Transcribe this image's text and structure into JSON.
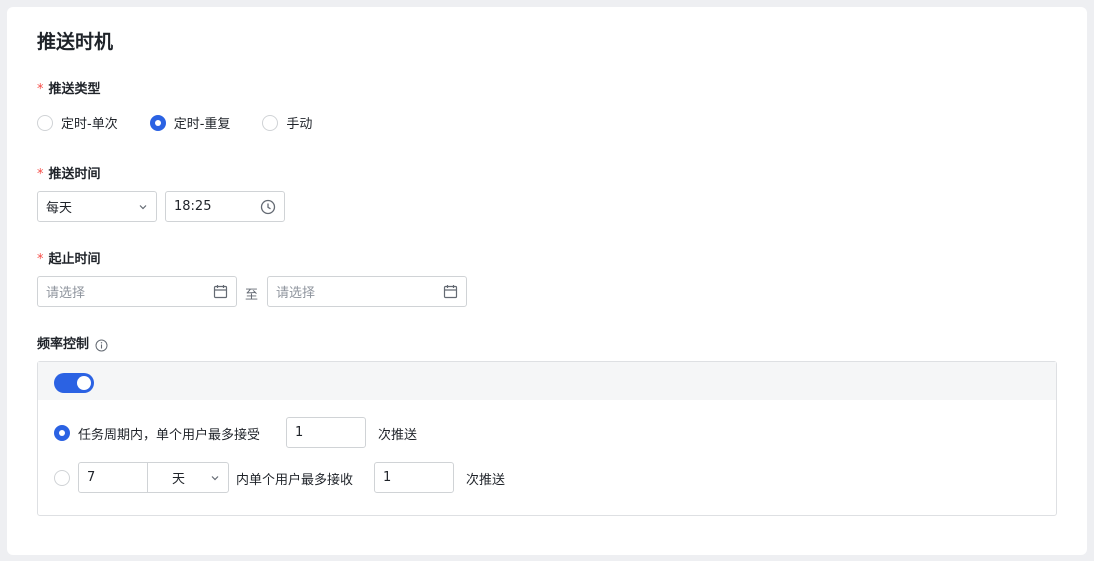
{
  "section_title": "推送时机",
  "push_type": {
    "label": "推送类型",
    "options": [
      {
        "label": "定时-单次",
        "checked": false
      },
      {
        "label": "定时-重复",
        "checked": true
      },
      {
        "label": "手动",
        "checked": false
      }
    ]
  },
  "push_time": {
    "label": "推送时间",
    "frequency_value": "每天",
    "time_value": "18:25"
  },
  "date_range": {
    "label": "起止时间",
    "start_placeholder": "请选择",
    "separator": "至",
    "end_placeholder": "请选择"
  },
  "frequency_control": {
    "label": "频率控制",
    "enabled": true,
    "rule1": {
      "checked": true,
      "prefix": "任务周期内，单个用户最多接受",
      "count": "1",
      "suffix": "次推送"
    },
    "rule2": {
      "checked": false,
      "period_value": "7",
      "unit_value": "天",
      "middle": "内单个用户最多接收",
      "count": "1",
      "suffix": "次推送"
    }
  },
  "required_mark": "*",
  "colors": {
    "accent": "#2b62e3",
    "required": "#f54a45"
  }
}
